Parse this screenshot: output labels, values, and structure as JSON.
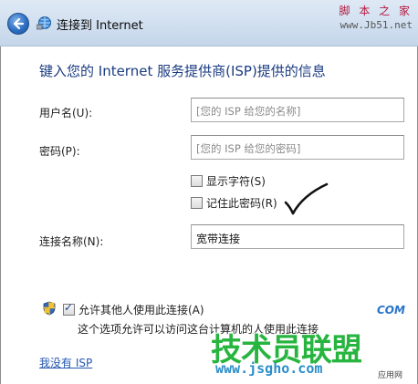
{
  "window": {
    "title": "连接到 Internet"
  },
  "watermark": {
    "top_text": "脚 本 之 家",
    "top_url": "www.Jb51.net",
    "big_text": "技术员联盟",
    "site_text": "www.jsgho.com",
    "com_text": "COM",
    "app_text": "应用网"
  },
  "form": {
    "heading": "键入您的 Internet 服务提供商(ISP)提供的信息",
    "username_label": "用户名(U):",
    "username_placeholder": "[您的 ISP 给您的名称]",
    "password_label": "密码(P):",
    "password_placeholder": "[您的 ISP 给您的密码]",
    "show_chars_label": "显示字符(S)",
    "show_chars_checked": false,
    "remember_label": "记住此密码(R)",
    "remember_checked": false,
    "conn_name_label": "连接名称(N):",
    "conn_name_value": "宽带连接",
    "allow_others_label": "允许其他人使用此连接(A)",
    "allow_others_checked": true,
    "allow_others_desc": "这个选项允许可以访问这台计算机的人使用此连接",
    "no_isp_link": "我没有 ISP"
  },
  "colors": {
    "heading": "#1b3c82",
    "link": "#2457b0",
    "titlebar": "#cfdeef"
  }
}
